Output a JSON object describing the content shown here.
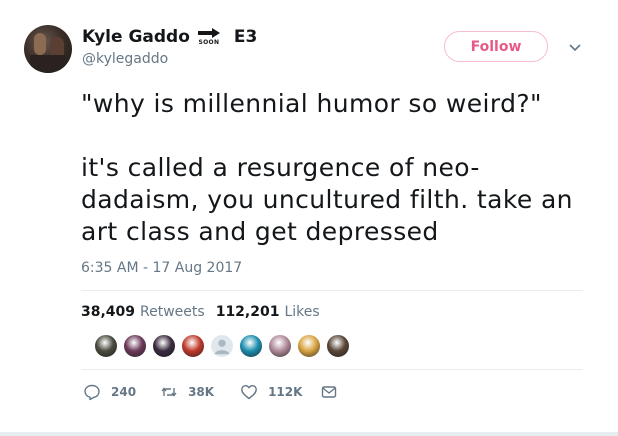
{
  "author": {
    "display_name": "Kyle Gaddo",
    "badge_text": "SOON",
    "name_suffix": "E3",
    "handle": "@kylegaddo"
  },
  "follow_label": "Follow",
  "tweet": {
    "text": "\"why is millennial humor so weird?\"\n\nit's called a resurgence of neo-dadaism, you uncultured filth. take an art class and get depressed",
    "timestamp": "6:35 AM - 17 Aug 2017"
  },
  "stats": {
    "retweets_count": "38,409",
    "retweets_label": "Retweets",
    "likes_count": "112,201",
    "likes_label": "Likes"
  },
  "liker_avatars": [
    {
      "icon": "avatar",
      "color": "#4a4a3e"
    },
    {
      "icon": "avatar",
      "color": "#6b3a5a"
    },
    {
      "icon": "avatar",
      "color": "#3a2b3f"
    },
    {
      "icon": "avatar",
      "color": "#c0392b"
    },
    {
      "icon": "default-avatar",
      "color": "#aab8c2"
    },
    {
      "icon": "avatar",
      "color": "#1d8fb0"
    },
    {
      "icon": "avatar",
      "color": "#b08a9a"
    },
    {
      "icon": "avatar",
      "color": "#d9a441"
    },
    {
      "icon": "avatar",
      "color": "#5a4636"
    }
  ],
  "actions": {
    "reply_count": "240",
    "retweet_count": "38K",
    "like_count": "112K"
  },
  "colors": {
    "follow_accent": "#e0245e",
    "secondary_text": "#657786"
  }
}
